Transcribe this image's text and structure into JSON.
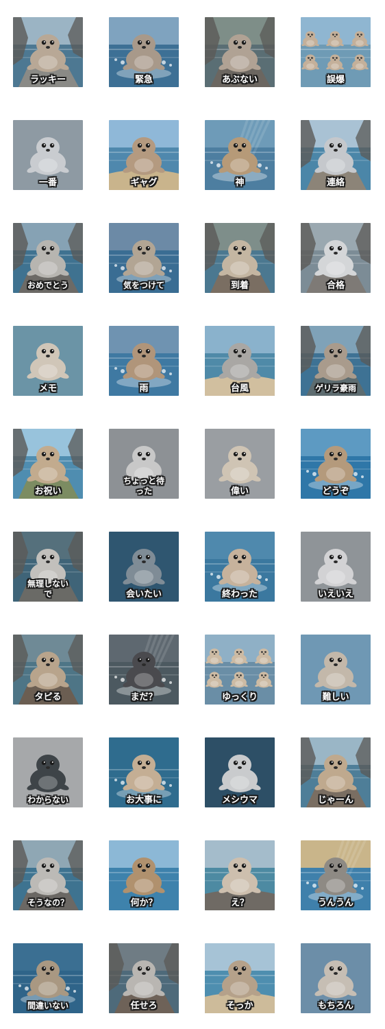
{
  "stickers": [
    {
      "label": "ラッキー",
      "theme": "cove",
      "sky": "#9bb4c4",
      "water": "#4d7892",
      "ground": "#8a8a86",
      "seal": "#b8a896"
    },
    {
      "label": "緊急",
      "theme": "splash",
      "sky": "#7fa3bf",
      "water": "#3d7095",
      "ground": "#3d7095",
      "seal": "#a8998a"
    },
    {
      "label": "あぶない",
      "theme": "rock",
      "sky": "#7e8e88",
      "water": "#5a6e74",
      "ground": "#6b6660",
      "seal": "#b0a294"
    },
    {
      "label": "誤爆",
      "theme": "crowd",
      "sky": "#8fb6d1",
      "water": "#6f9bb5",
      "ground": "#a89c8a",
      "seal": "#c4b09a"
    },
    {
      "label": "一番",
      "theme": "plain",
      "sky": "#8e9aa3",
      "water": "#8e9aa3",
      "ground": "#7a6e66",
      "seal": "#c9ccd0"
    },
    {
      "label": "ギャグ",
      "theme": "beach",
      "sky": "#8fb8d8",
      "water": "#4f88ad",
      "ground": "#c9b48c",
      "seal": "#b49a80"
    },
    {
      "label": "神",
      "theme": "sunray",
      "sky": "#6e9bb8",
      "water": "#4d7ea0",
      "ground": "#4d7ea0",
      "seal": "#b69a78"
    },
    {
      "label": "連絡",
      "theme": "rock",
      "sky": "#a9c2d4",
      "water": "#4b86a8",
      "ground": "#8c8478",
      "seal": "#c5c8cc"
    },
    {
      "label": "おめでとう",
      "theme": "cove",
      "sky": "#86a2b4",
      "water": "#3f7290",
      "ground": "#6c6a66",
      "seal": "#b7b5b0"
    },
    {
      "label": "気をつけて",
      "theme": "splash",
      "sky": "#6c8aa6",
      "water": "#3a6d93",
      "ground": "#3a6d93",
      "seal": "#b2a594"
    },
    {
      "label": "到着",
      "theme": "cove",
      "sky": "#7e8e8a",
      "water": "#4b7890",
      "ground": "#7a6e62",
      "seal": "#c4b6a2"
    },
    {
      "label": "合格",
      "theme": "rock",
      "sky": "#9aa8b0",
      "water": "#7c8c96",
      "ground": "#7e7a76",
      "seal": "#d4d6d8"
    },
    {
      "label": "メモ",
      "theme": "plain",
      "sky": "#6b94a6",
      "water": "#6b94a6",
      "ground": "#4a6e80",
      "seal": "#d0c6b8"
    },
    {
      "label": "雨",
      "theme": "splash",
      "sky": "#6f93b1",
      "water": "#3f79a2",
      "ground": "#3f79a2",
      "seal": "#b0957a"
    },
    {
      "label": "台風",
      "theme": "beach",
      "sky": "#8ab2cc",
      "water": "#4f8aa8",
      "ground": "#d1bf9f",
      "seal": "#a9a7a4"
    },
    {
      "label": "ゲリラ豪雨",
      "theme": "cove",
      "sky": "#7fa2b8",
      "water": "#3e7294",
      "ground": "#5d6c70",
      "seal": "#a99b8c"
    },
    {
      "label": "お祝い",
      "theme": "cove",
      "sky": "#98c3dc",
      "water": "#4f8db0",
      "ground": "#7c8c62",
      "seal": "#c2ab8e"
    },
    {
      "label": "ちょっと待\nった",
      "theme": "plain",
      "sky": "#8d9195",
      "water": "#8d9195",
      "ground": "#8d9195",
      "seal": "#c8c8c8"
    },
    {
      "label": "偉い",
      "theme": "plain",
      "sky": "#9a9ea2",
      "water": "#9a9ea2",
      "ground": "#9a9ea2",
      "seal": "#cfc4b4"
    },
    {
      "label": "どうぞ",
      "theme": "splash",
      "sky": "#5d9ac2",
      "water": "#2f77a8",
      "ground": "#2f77a8",
      "seal": "#b49a7c"
    },
    {
      "label": "無理しない\nで",
      "theme": "rock",
      "sky": "#55707c",
      "water": "#3f6478",
      "ground": "#6a6a66",
      "seal": "#c2c0bc"
    },
    {
      "label": "会いたい",
      "theme": "plain",
      "sky": "#2f5670",
      "water": "#2f5670",
      "ground": "#2f5670",
      "seal": "#7f8c96"
    },
    {
      "label": "終わった",
      "theme": "splash",
      "sky": "#4f89ad",
      "water": "#3b789f",
      "ground": "#3b789f",
      "seal": "#c6b29c"
    },
    {
      "label": "いえいえ",
      "theme": "plain",
      "sky": "#8f9498",
      "water": "#8f9498",
      "ground": "#8f9498",
      "seal": "#d2d2d4"
    },
    {
      "label": "タピる",
      "theme": "rock",
      "sky": "#6f8a96",
      "water": "#4e7586",
      "ground": "#6b5e52",
      "seal": "#b8a48c"
    },
    {
      "label": "まだ？",
      "theme": "sunray",
      "sky": "#5e6870",
      "water": "#4c5960",
      "ground": "#4c5960",
      "seal": "#4a4a4e"
    },
    {
      "label": "ゆっくり",
      "theme": "crowd",
      "sky": "#8fb0c6",
      "water": "#6a8ea6",
      "ground": "#7b7c7a",
      "seal": "#cdbba4"
    },
    {
      "label": "難しい",
      "theme": "plain",
      "sky": "#6f98b4",
      "water": "#4c7a9a",
      "ground": "#4c7a9a",
      "seal": "#c3b8aa"
    },
    {
      "label": "わからない",
      "theme": "plain",
      "sky": "#a6a8aa",
      "water": "#a6a8aa",
      "ground": "#a6a8aa",
      "seal": "#3e4448"
    },
    {
      "label": "お大事に",
      "theme": "splash",
      "sky": "#2f6c8e",
      "water": "#2f6c8e",
      "ground": "#2f6c8e",
      "seal": "#c4ae94"
    },
    {
      "label": "メシウマ",
      "theme": "plain",
      "sky": "#2d4f66",
      "water": "#2d4f66",
      "ground": "#2d4f66",
      "seal": "#c9cbcd"
    },
    {
      "label": "じゃーん",
      "theme": "cove",
      "sky": "#9ab6c6",
      "water": "#4e7e98",
      "ground": "#7a6e62",
      "seal": "#bfa98e"
    },
    {
      "label": "そうなの？",
      "theme": "cove",
      "sky": "#8fa7b4",
      "water": "#3e7390",
      "ground": "#6b6864",
      "seal": "#bcbab6"
    },
    {
      "label": "何か？",
      "theme": "beach",
      "sky": "#8cb8d6",
      "water": "#3e82ac",
      "ground": "#3e82ac",
      "seal": "#b0916e"
    },
    {
      "label": "え？",
      "theme": "beach",
      "sky": "#a4bccb",
      "water": "#4d8aa2",
      "ground": "#6f6a64",
      "seal": "#cdbfae"
    },
    {
      "label": "うんうん",
      "theme": "sunray",
      "sky": "#c9b58a",
      "water": "#3f80ab",
      "ground": "#3f80ab",
      "seal": "#8e8a84"
    },
    {
      "label": "間違いない",
      "theme": "splash",
      "sky": "#3b6f92",
      "water": "#2f6489",
      "ground": "#2f6489",
      "seal": "#a99882"
    },
    {
      "label": "任せろ",
      "theme": "rock",
      "sky": "#6f7c84",
      "water": "#4e6a7a",
      "ground": "#6e6258",
      "seal": "#b9b6b2"
    },
    {
      "label": "そっか",
      "theme": "beach",
      "sky": "#a6c3d6",
      "water": "#4e8eaf",
      "ground": "#cdbb9a",
      "seal": "#b5a18a"
    },
    {
      "label": "もちろん",
      "theme": "plain",
      "sky": "#6c8ea8",
      "water": "#4c7290",
      "ground": "#4c7290",
      "seal": "#c6beb4"
    }
  ]
}
